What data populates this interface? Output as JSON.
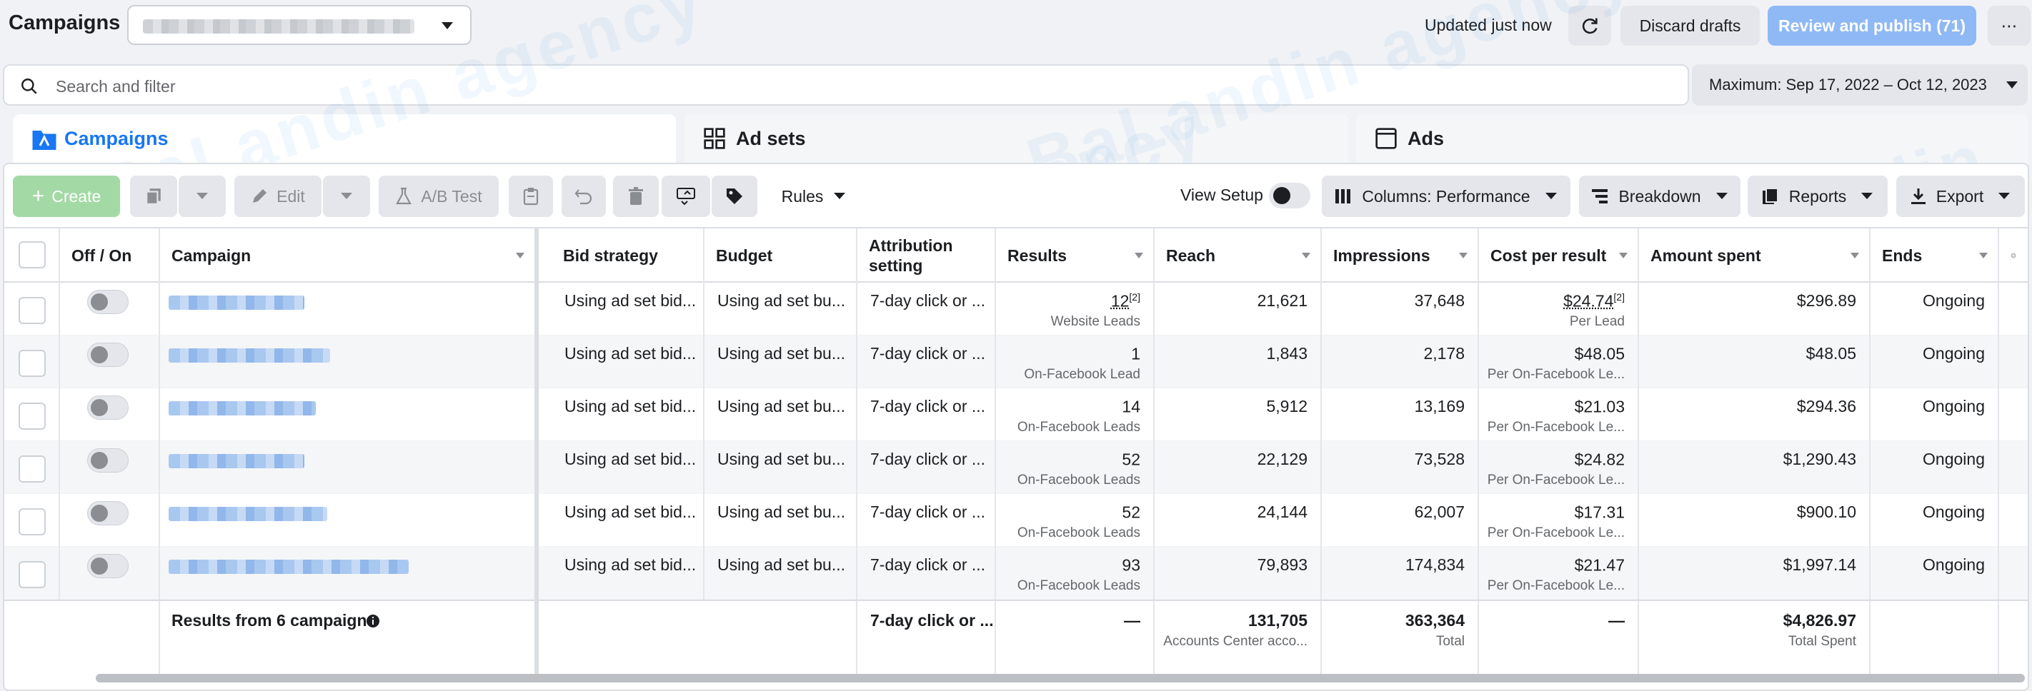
{
  "header": {
    "title": "Campaigns",
    "updated": "Updated just now",
    "discard": "Discard drafts",
    "publish": "Review and publish (71)",
    "more": "⋯"
  },
  "search": {
    "placeholder": "Search and filter"
  },
  "date_range": "Maximum: Sep 17, 2022 – Oct 12, 2023",
  "tabs": [
    {
      "label": "Campaigns",
      "active": true
    },
    {
      "label": "Ad sets",
      "active": false
    },
    {
      "label": "Ads",
      "active": false
    }
  ],
  "toolbar": {
    "create": "Create",
    "edit": "Edit",
    "ab_test": "A/B Test",
    "rules": "Rules",
    "view_setup": "View Setup",
    "columns": "Columns: Performance",
    "breakdown": "Breakdown",
    "reports": "Reports",
    "export": "Export"
  },
  "columns": [
    "Off / On",
    "Campaign",
    "Bid strategy",
    "Budget",
    "Attribution setting",
    "Results",
    "Reach",
    "Impressions",
    "Cost per result",
    "Amount spent",
    "Ends"
  ],
  "rows": [
    {
      "bid": "Using ad set bid...",
      "budget": "Using ad set bu...",
      "attr": "7-day click or ...",
      "results": "12",
      "results_sup": "[2]",
      "results_sub": "Website Leads",
      "reach": "21,621",
      "impr": "37,648",
      "cpr": "$24.74",
      "cpr_sup": "[2]",
      "cpr_sub": "Per Lead",
      "spent": "$296.89",
      "ends": "Ongoing"
    },
    {
      "bid": "Using ad set bid...",
      "budget": "Using ad set bu...",
      "attr": "7-day click or ...",
      "results": "1",
      "results_sup": "",
      "results_sub": "On-Facebook Lead",
      "reach": "1,843",
      "impr": "2,178",
      "cpr": "$48.05",
      "cpr_sup": "",
      "cpr_sub": "Per On-Facebook Le...",
      "spent": "$48.05",
      "ends": "Ongoing"
    },
    {
      "bid": "Using ad set bid...",
      "budget": "Using ad set bu...",
      "attr": "7-day click or ...",
      "results": "14",
      "results_sup": "",
      "results_sub": "On-Facebook Leads",
      "reach": "5,912",
      "impr": "13,169",
      "cpr": "$21.03",
      "cpr_sup": "",
      "cpr_sub": "Per On-Facebook Le...",
      "spent": "$294.36",
      "ends": "Ongoing"
    },
    {
      "bid": "Using ad set bid...",
      "budget": "Using ad set bu...",
      "attr": "7-day click or ...",
      "results": "52",
      "results_sup": "",
      "results_sub": "On-Facebook Leads",
      "reach": "22,129",
      "impr": "73,528",
      "cpr": "$24.82",
      "cpr_sup": "",
      "cpr_sub": "Per On-Facebook Le...",
      "spent": "$1,290.43",
      "ends": "Ongoing"
    },
    {
      "bid": "Using ad set bid...",
      "budget": "Using ad set bu...",
      "attr": "7-day click or ...",
      "results": "52",
      "results_sup": "",
      "results_sub": "On-Facebook Leads",
      "reach": "24,144",
      "impr": "62,007",
      "cpr": "$17.31",
      "cpr_sup": "",
      "cpr_sub": "Per On-Facebook Le...",
      "spent": "$900.10",
      "ends": "Ongoing"
    },
    {
      "bid": "Using ad set bid...",
      "budget": "Using ad set bu...",
      "attr": "7-day click or ...",
      "results": "93",
      "results_sup": "",
      "results_sub": "On-Facebook Leads",
      "reach": "79,893",
      "impr": "174,834",
      "cpr": "$21.47",
      "cpr_sup": "",
      "cpr_sub": "Per On-Facebook Le...",
      "spent": "$1,997.14",
      "ends": "Ongoing"
    }
  ],
  "totals": {
    "label": "Results from 6 campaigns",
    "attr": "7-day click or ...",
    "results": "—",
    "reach": "131,705",
    "reach_sub": "Accounts Center acco...",
    "impr": "363,364",
    "impr_sub": "Total",
    "cpr": "—",
    "spent": "$4,826.97",
    "spent_sub": "Total Spent"
  },
  "watermark": "BaLandin agency",
  "colors": {
    "accent": "#1877f2",
    "create_green": "#a3d9a5",
    "publish_blue": "#8fb9f5"
  }
}
